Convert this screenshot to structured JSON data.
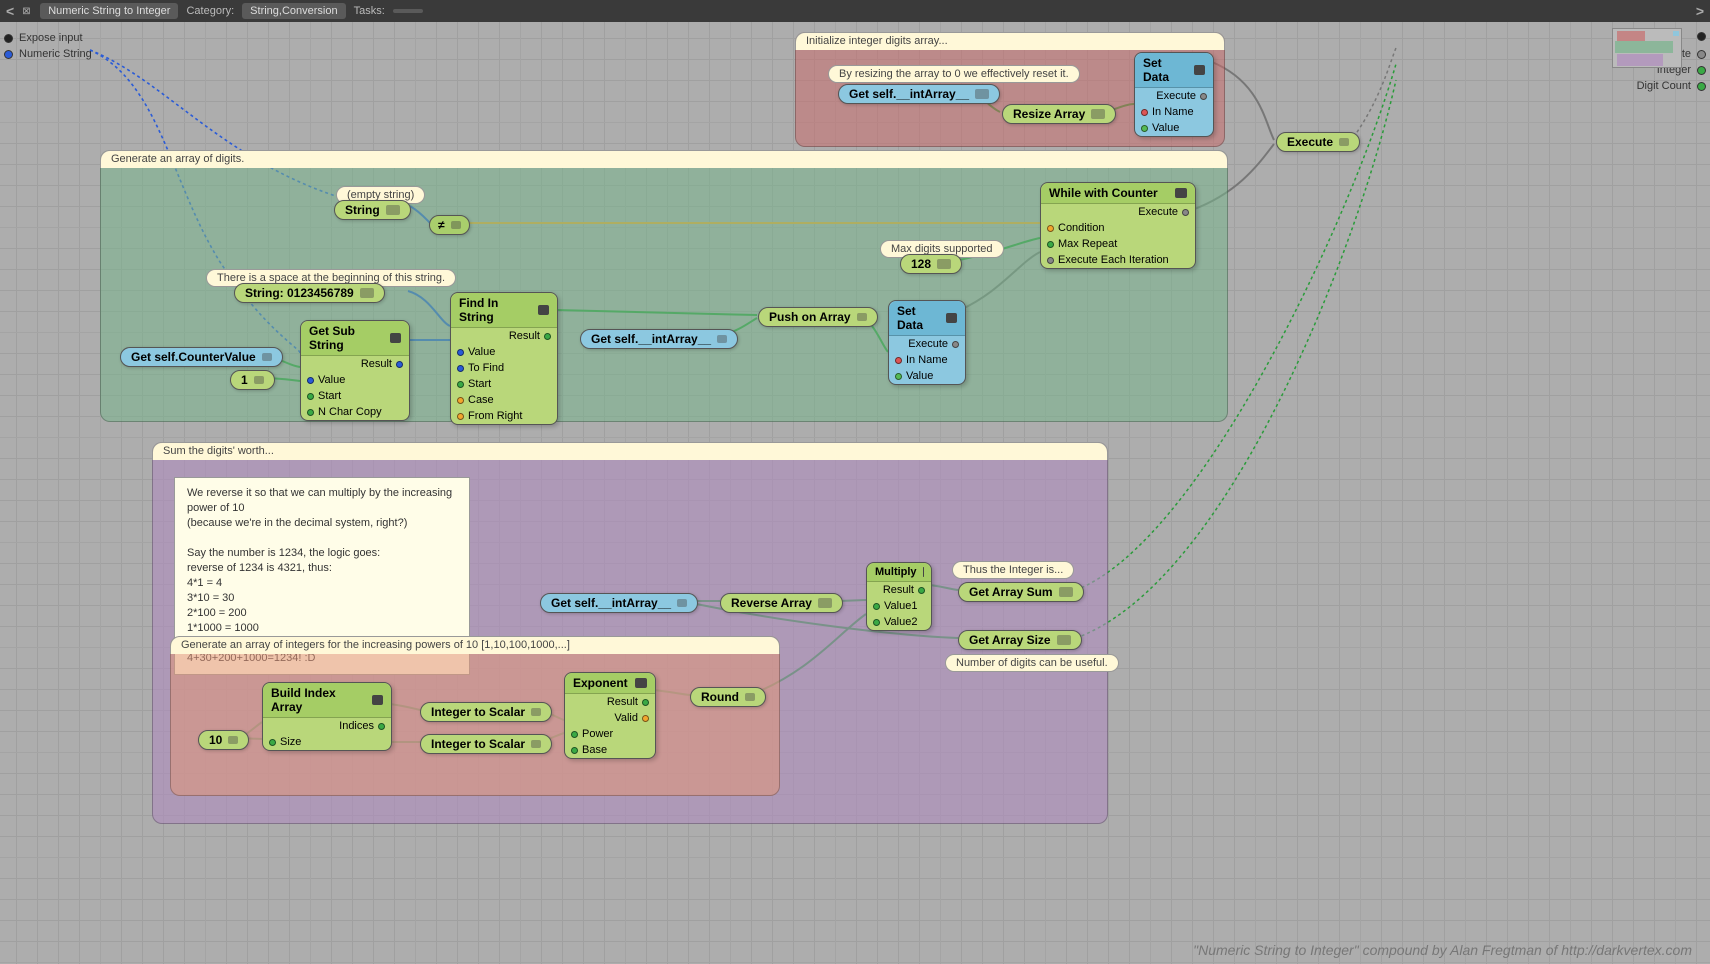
{
  "topbar": {
    "title": "Numeric String to Integer",
    "category_label": "Category:",
    "category_value": "String,Conversion",
    "tasks_label": "Tasks:"
  },
  "inputs": {
    "expose": "Expose input",
    "numeric_string": "Numeric String"
  },
  "outputs": {
    "evaluate": "Evaluate",
    "integer": "Integer",
    "digit_count": "Digit Count"
  },
  "groups": {
    "init": "Initialize integer digits array...",
    "gen": "Generate an array of digits.",
    "sum": "Sum the digits' worth...",
    "pow": "Generate an array of integers for the increasing powers of 10  [1,10,100,1000,...]"
  },
  "annotations": {
    "reset": "By resizing the array to 0 we effectively reset it.",
    "empty": "(empty string)",
    "spacewarn": "There is a space at the beginning of this string.",
    "maxdigits": "Max digits supported",
    "thusint": "Thus the Integer is...",
    "numdigits": "Number of digits can be useful."
  },
  "note_text": "We reverse it so that we can multiply by the increasing power of 10\n(because we're in the decimal system, right?)\n\nSay the number is 1234, the logic goes:\nreverse of 1234 is 4321, thus:\n4*1 = 4\n3*10 = 30\n2*100 = 200\n1*1000 = 1000\nand it's in an array, so when we get the sum:\n4+30+200+1000=1234! :D",
  "nodes": {
    "get_int_array1": "Get self.__intArray__",
    "resize_array": "Resize Array",
    "set_data1_title": "Set Data",
    "set_data_execute": "Execute",
    "set_data_inname": "In Name",
    "set_data_value": "Value",
    "execute": "Execute",
    "string": "String",
    "neq": "≠",
    "string_digits": "String:  0123456789",
    "get_counter": "Get self.CounterValue",
    "one": "1",
    "get_sub_title": "Get Sub String",
    "get_sub_result": "Result",
    "get_sub_value": "Value",
    "get_sub_start": "Start",
    "get_sub_nchar": "N Char Copy",
    "find_title": "Find In String",
    "find_result": "Result",
    "find_value": "Value",
    "find_tofind": "To Find",
    "find_start": "Start",
    "find_case": "Case",
    "find_fromright": "From Right",
    "get_int_array2": "Get self.__intArray__",
    "push_array": "Push on Array",
    "set_data2_title": "Set Data",
    "num128": "128",
    "while_title": "While with Counter",
    "while_execute": "Execute",
    "while_condition": "Condition",
    "while_maxrepeat": "Max Repeat",
    "while_eachiter": "Execute Each Iteration",
    "get_int_array3": "Get self.__intArray__",
    "reverse_array": "Reverse Array",
    "multiply_title": "Multiply",
    "multiply_result": "Result",
    "multiply_v1": "Value1",
    "multiply_v2": "Value2",
    "get_array_sum": "Get Array Sum",
    "get_array_size": "Get Array Size",
    "ten": "10",
    "build_idx_title": "Build Index Array",
    "build_idx_indices": "Indices",
    "build_idx_size": "Size",
    "int_to_scalar1": "Integer to Scalar",
    "int_to_scalar2": "Integer to Scalar",
    "exp_title": "Exponent",
    "exp_result": "Result",
    "exp_valid": "Valid",
    "exp_power": "Power",
    "exp_base": "Base",
    "round": "Round"
  },
  "credit": "\"Numeric String to Integer\" compound by Alan Fregtman of http://darkvertex.com"
}
